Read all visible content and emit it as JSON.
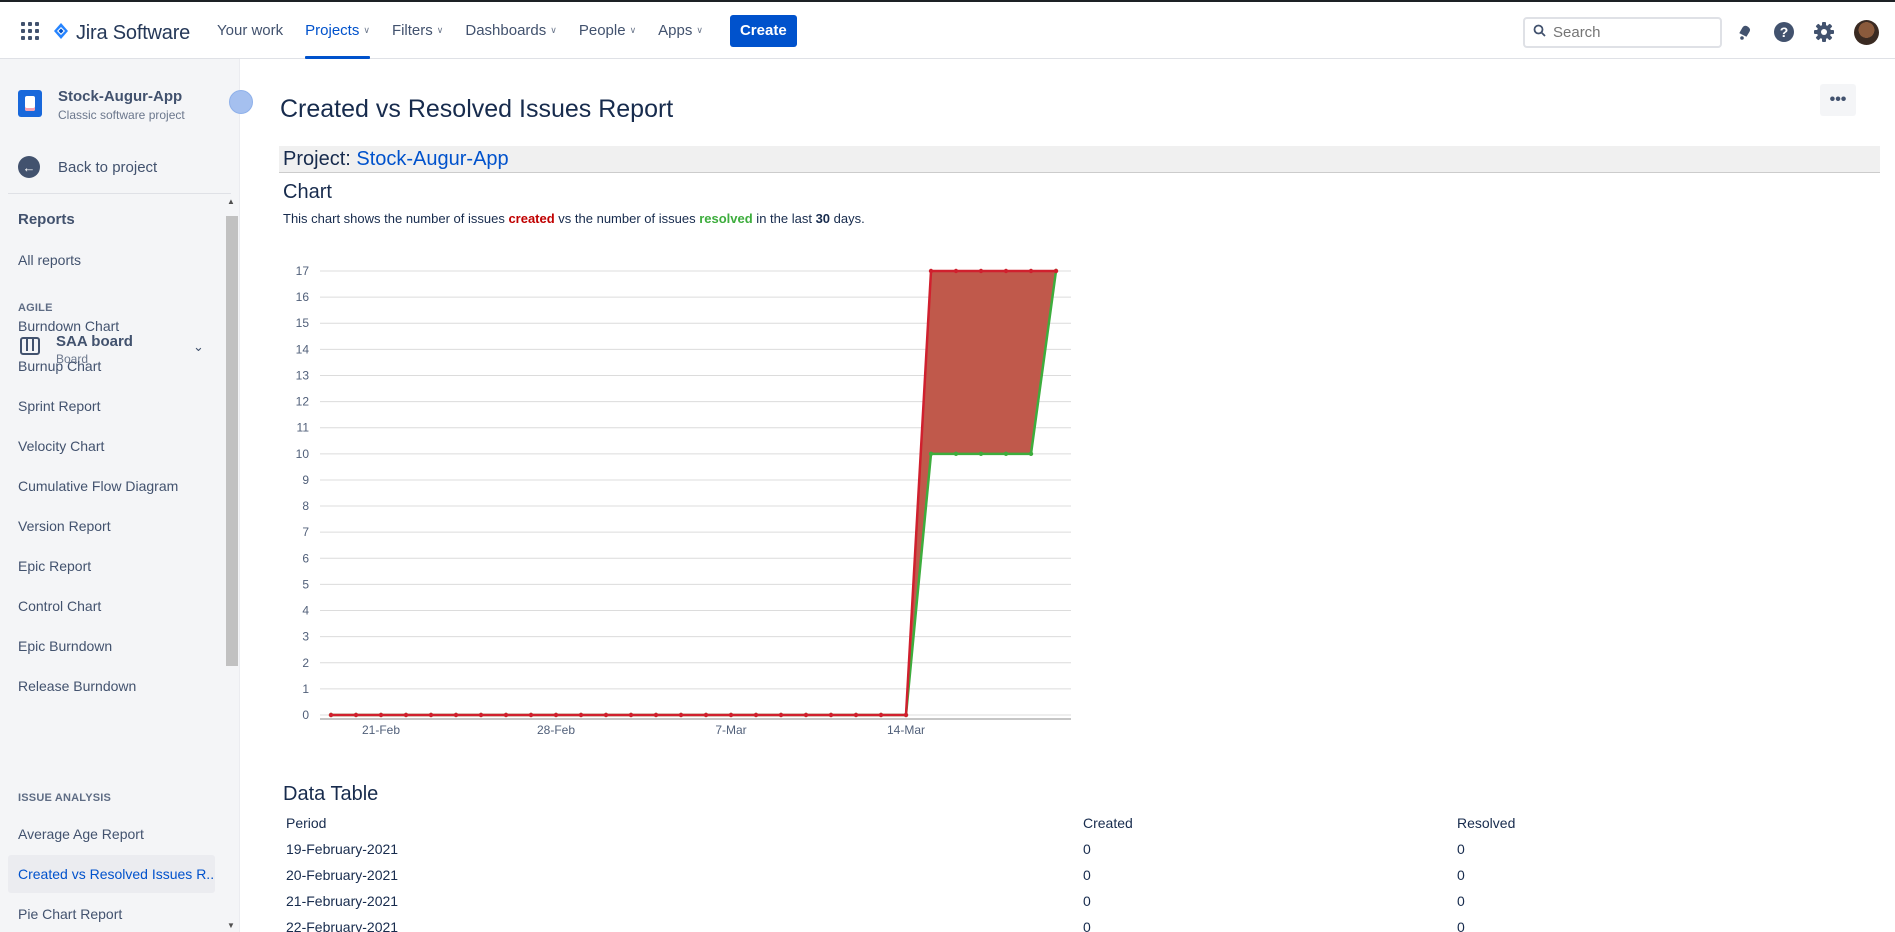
{
  "app": {
    "name": "Jira Software"
  },
  "nav": {
    "items": [
      {
        "label": "Your work",
        "dropdown": false
      },
      {
        "label": "Projects",
        "dropdown": true,
        "active": true
      },
      {
        "label": "Filters",
        "dropdown": true
      },
      {
        "label": "Dashboards",
        "dropdown": true
      },
      {
        "label": "People",
        "dropdown": true
      },
      {
        "label": "Apps",
        "dropdown": true
      }
    ],
    "create_label": "Create",
    "search_placeholder": "Search"
  },
  "sidebar": {
    "project_name": "Stock-Augur-App",
    "project_type": "Classic software project",
    "back_label": "Back to project",
    "reports_heading": "Reports",
    "all_reports": "All reports",
    "agile_section": "AGILE",
    "board_name": "SAA board",
    "board_type": "Board",
    "agile_items": [
      "Burndown Chart",
      "Burnup Chart",
      "Sprint Report",
      "Velocity Chart",
      "Cumulative Flow Diagram",
      "Version Report",
      "Epic Report",
      "Control Chart",
      "Epic Burndown",
      "Release Burndown"
    ],
    "issue_section": "ISSUE ANALYSIS",
    "issue_items": [
      "Average Age Report",
      "Created vs Resolved Issues R...",
      "Pie Chart Report"
    ],
    "selected_item": "Created vs Resolved Issues R..."
  },
  "main": {
    "title": "Created vs Resolved Issues Report",
    "project_label": "Project:",
    "project_link": "Stock-Augur-App",
    "chart_heading": "Chart",
    "desc": {
      "p1": "This chart shows the number of issues ",
      "created": "created",
      "p2": " vs the number of issues ",
      "resolved": "resolved",
      "p3": " in the last ",
      "days": "30",
      "p4": " days."
    },
    "data_table_heading": "Data Table",
    "table": {
      "columns": [
        "Period",
        "Created",
        "Resolved"
      ],
      "rows": [
        [
          "19-February-2021",
          "0",
          "0"
        ],
        [
          "20-February-2021",
          "0",
          "0"
        ],
        [
          "21-February-2021",
          "0",
          "0"
        ],
        [
          "22-February-2021",
          "0",
          "0"
        ]
      ]
    }
  },
  "chart_data": {
    "type": "area",
    "x": [
      "19-Feb",
      "20-Feb",
      "21-Feb",
      "22-Feb",
      "23-Feb",
      "24-Feb",
      "25-Feb",
      "26-Feb",
      "27-Feb",
      "28-Feb",
      "1-Mar",
      "2-Mar",
      "3-Mar",
      "4-Mar",
      "5-Mar",
      "6-Mar",
      "7-Mar",
      "8-Mar",
      "9-Mar",
      "10-Mar",
      "11-Mar",
      "12-Mar",
      "13-Mar",
      "14-Mar",
      "15-Mar",
      "16-Mar",
      "17-Mar",
      "18-Mar",
      "19-Mar",
      "20-Mar"
    ],
    "x_ticks": [
      "21-Feb",
      "28-Feb",
      "7-Mar",
      "14-Mar"
    ],
    "series": [
      {
        "name": "created",
        "color": "#d0202e",
        "values": [
          0,
          0,
          0,
          0,
          0,
          0,
          0,
          0,
          0,
          0,
          0,
          0,
          0,
          0,
          0,
          0,
          0,
          0,
          0,
          0,
          0,
          0,
          0,
          0,
          17,
          17,
          17,
          17,
          17,
          17
        ]
      },
      {
        "name": "resolved",
        "color": "#3dad3d",
        "values": [
          0,
          0,
          0,
          0,
          0,
          0,
          0,
          0,
          0,
          0,
          0,
          0,
          0,
          0,
          0,
          0,
          0,
          0,
          0,
          0,
          0,
          0,
          0,
          0,
          10,
          10,
          10,
          10,
          10,
          17
        ]
      }
    ],
    "fill_color": "#c0594b",
    "ylim": [
      0,
      17
    ],
    "y_ticks": [
      0,
      1,
      2,
      3,
      4,
      5,
      6,
      7,
      8,
      9,
      10,
      11,
      12,
      13,
      14,
      15,
      16,
      17
    ],
    "grid": true
  }
}
